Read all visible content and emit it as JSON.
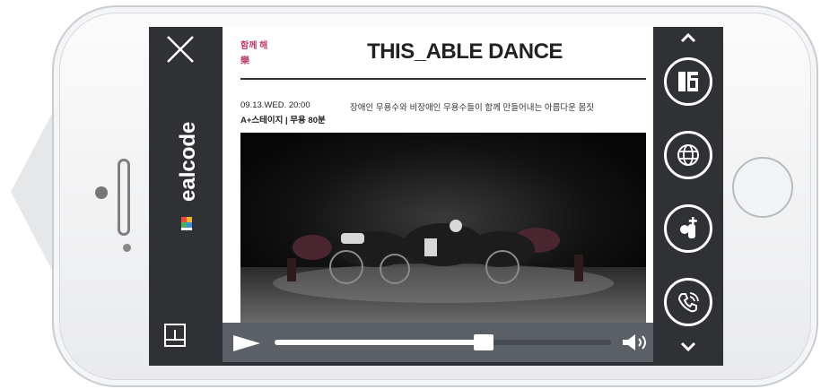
{
  "brand": {
    "logo_text": "ealcode"
  },
  "article": {
    "tag_lines": [
      "함께 해",
      "樂"
    ],
    "title": "THIS_ABLE DANCE",
    "date_time": "09.13.WED. 20:00",
    "venue_genre": "A+스테이지 | 무용 80분",
    "description": "장애인 무용수와 비장애인 무용수들이 함께 만들어내는 아름다운 몸짓"
  },
  "player": {
    "progress": 0.62
  },
  "icons": {
    "close": "close-icon",
    "bookmark": "bookmark-icon",
    "scroll_up": "chevron-up-icon",
    "scroll_down": "chevron-down-icon",
    "share": "share-icon",
    "globe": "globe-icon",
    "add_favorite": "add-favorite-icon",
    "phone": "phone-icon",
    "play": "play-icon",
    "volume": "volume-icon"
  },
  "colors": {
    "accent": "#c23a6b",
    "panel": "#2f3135",
    "player": "#5b5f66"
  }
}
